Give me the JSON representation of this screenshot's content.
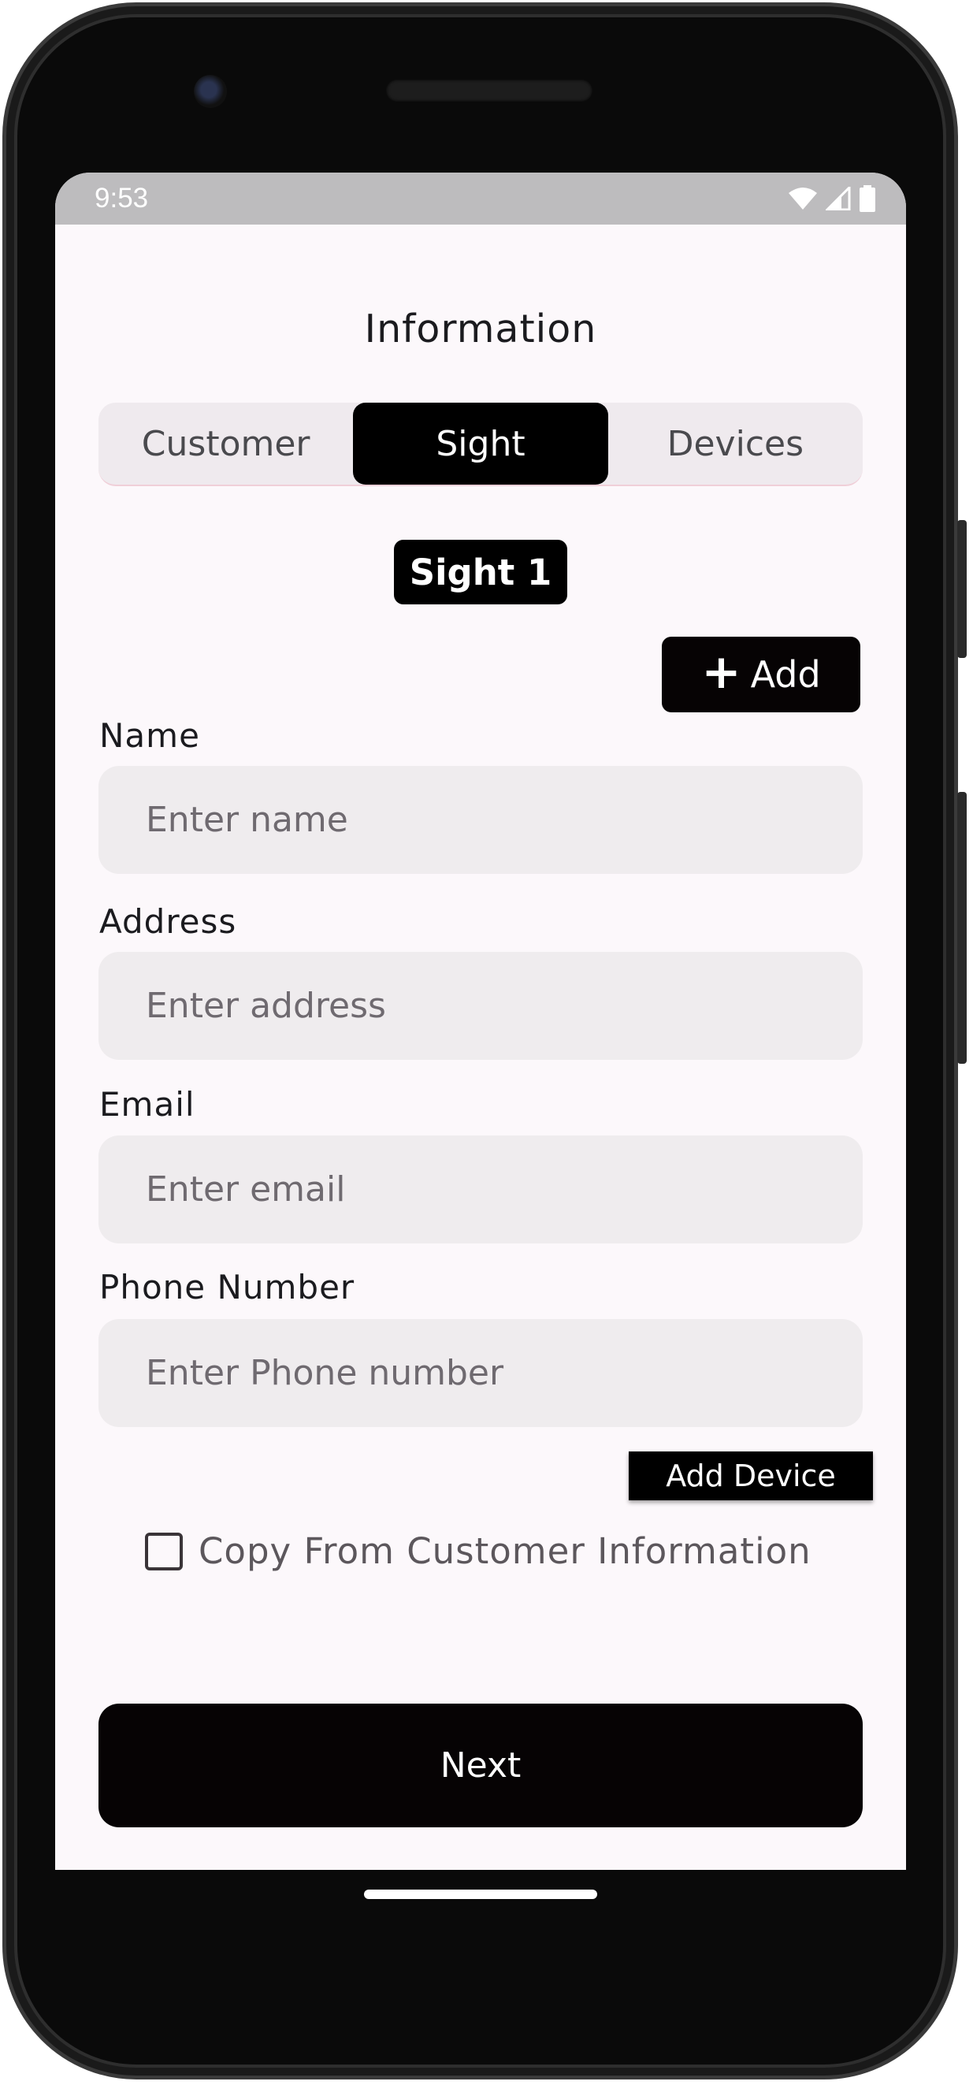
{
  "status_bar": {
    "time": "9:53",
    "icons": [
      "wifi-icon",
      "cellular-signal-icon",
      "battery-icon"
    ]
  },
  "page": {
    "title": "Information"
  },
  "tabs": [
    {
      "label": "Customer",
      "active": false
    },
    {
      "label": "Sight",
      "active": true
    },
    {
      "label": "Devices",
      "active": false
    }
  ],
  "sight_chip": "Sight 1",
  "add_button": {
    "label": "Add",
    "icon": "plus-icon"
  },
  "form": {
    "name": {
      "label": "Name",
      "placeholder": "Enter name",
      "value": ""
    },
    "address": {
      "label": "Address",
      "placeholder": "Enter address",
      "value": ""
    },
    "email": {
      "label": "Email",
      "placeholder": "Enter email",
      "value": ""
    },
    "phone": {
      "label": "Phone Number",
      "placeholder": "Enter Phone number",
      "value": ""
    }
  },
  "add_device_label": "Add Device",
  "copy_checkbox": {
    "label": "Copy From Customer Information",
    "checked": false
  },
  "next_label": "Next",
  "colors": {
    "primary": "#000000",
    "background": "#fcf8fb",
    "input_bg": "#efecee",
    "status_bar": "#bdbcbe"
  }
}
